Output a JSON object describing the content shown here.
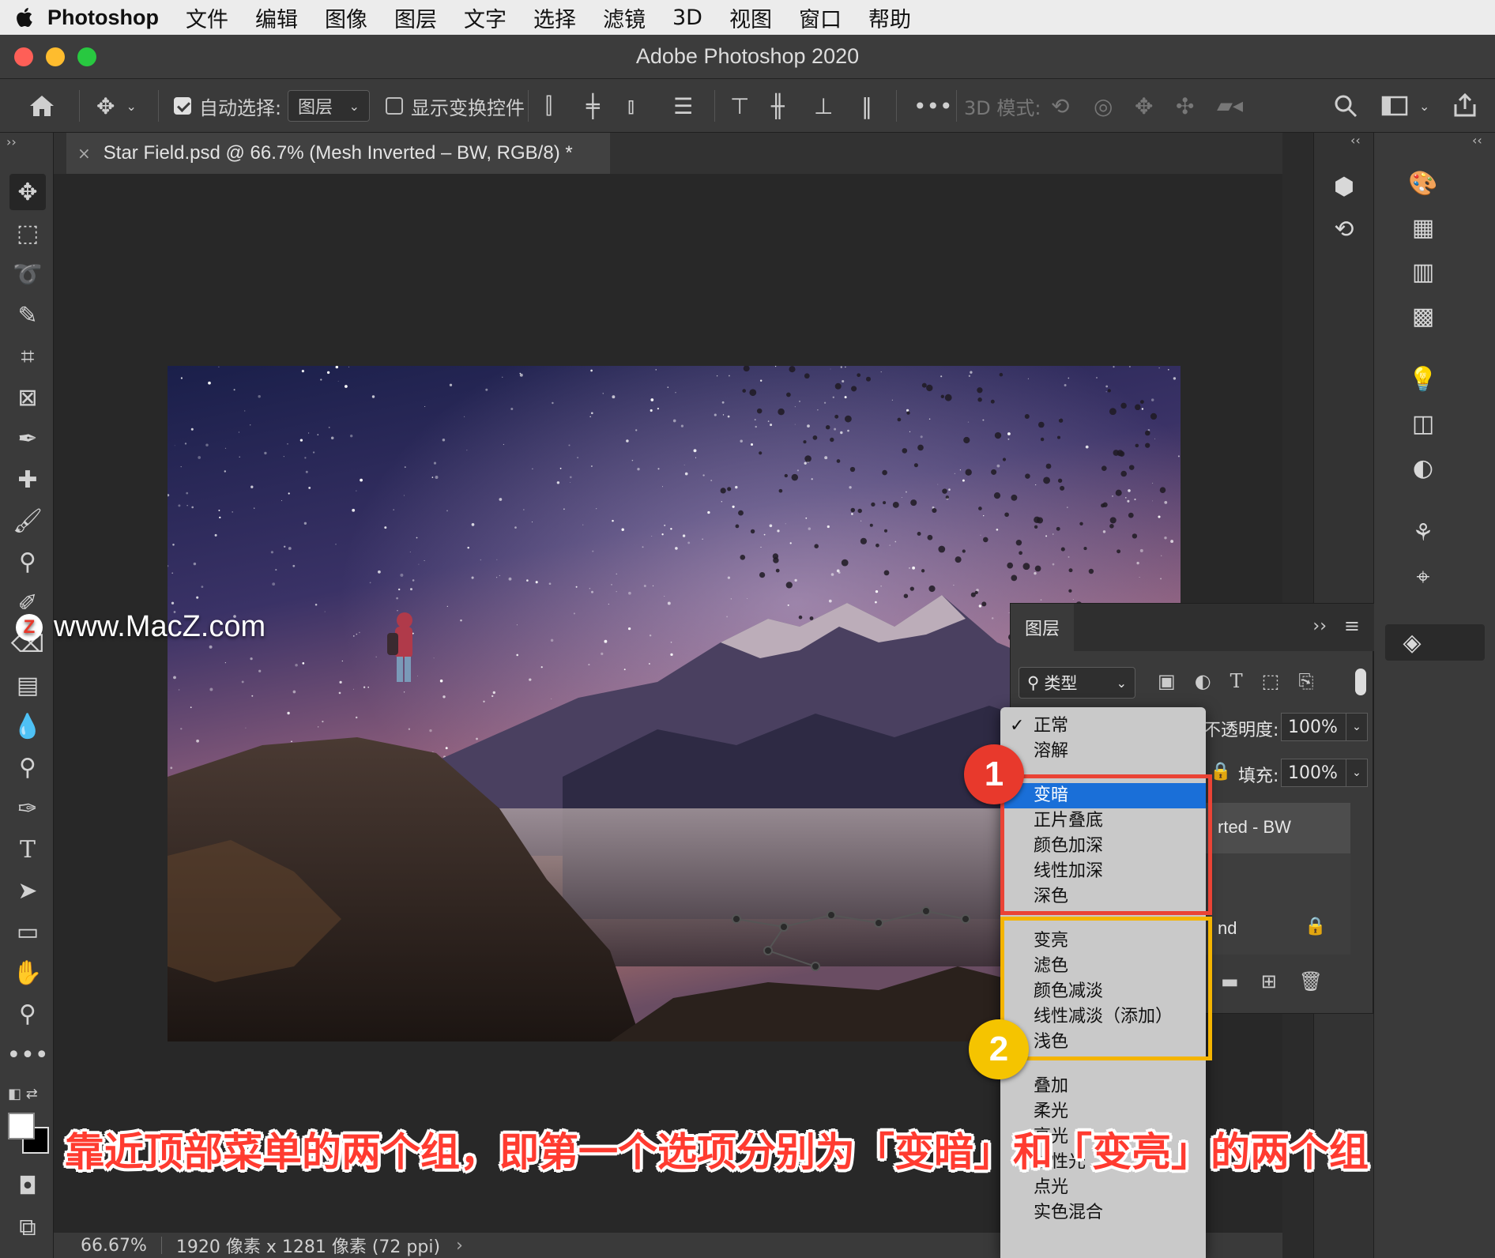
{
  "menubar": {
    "app": "Photoshop",
    "items": [
      "文件",
      "编辑",
      "图像",
      "图层",
      "文字",
      "选择",
      "滤镜",
      "3D",
      "视图",
      "窗口",
      "帮助"
    ]
  },
  "window": {
    "title": "Adobe Photoshop 2020"
  },
  "options": {
    "auto_select_label": "自动选择:",
    "auto_select_checked": true,
    "auto_select_value": "图层",
    "show_transform_label": "显示变换控件",
    "show_transform_checked": false,
    "mode_3d_label": "3D 模式:"
  },
  "document": {
    "tab_title": "Star Field.psd @ 66.7% (Mesh Inverted – BW, RGB/8) *",
    "zoom": "66.67%",
    "dimensions": "1920 像素 x 1281 像素 (72 ppi)"
  },
  "layers_panel": {
    "tab": "图层",
    "filter_label": "类型",
    "opacity_label": "不透明度:",
    "opacity_value": "100%",
    "fill_label": "填充:",
    "fill_value": "100%",
    "layer_partial_1": "rted - BW",
    "layer_partial_2": "nd"
  },
  "blend_menu": {
    "selected": "正常",
    "highlighted": "变暗",
    "groups": [
      [
        "正常",
        "溶解"
      ],
      [
        "变暗",
        "正片叠底",
        "颜色加深",
        "线性加深",
        "深色"
      ],
      [
        "变亮",
        "滤色",
        "颜色减淡",
        "线性减淡（添加）",
        "浅色"
      ],
      [
        "叠加",
        "柔光",
        "亮光",
        "线性光",
        "点光",
        "实色混合"
      ]
    ]
  },
  "annotations": {
    "badge_1": "1",
    "badge_2": "2",
    "badge_1_color": "#e8392c",
    "badge_2_color": "#f5c400",
    "frame_1_color": "#ea4335",
    "frame_2_color": "#f4b400",
    "caption": "靠近顶部菜单的两个组，即第一个选项分别为「变暗」和「变亮」的两个组"
  },
  "watermark": {
    "text": "www.MacZ.com"
  }
}
